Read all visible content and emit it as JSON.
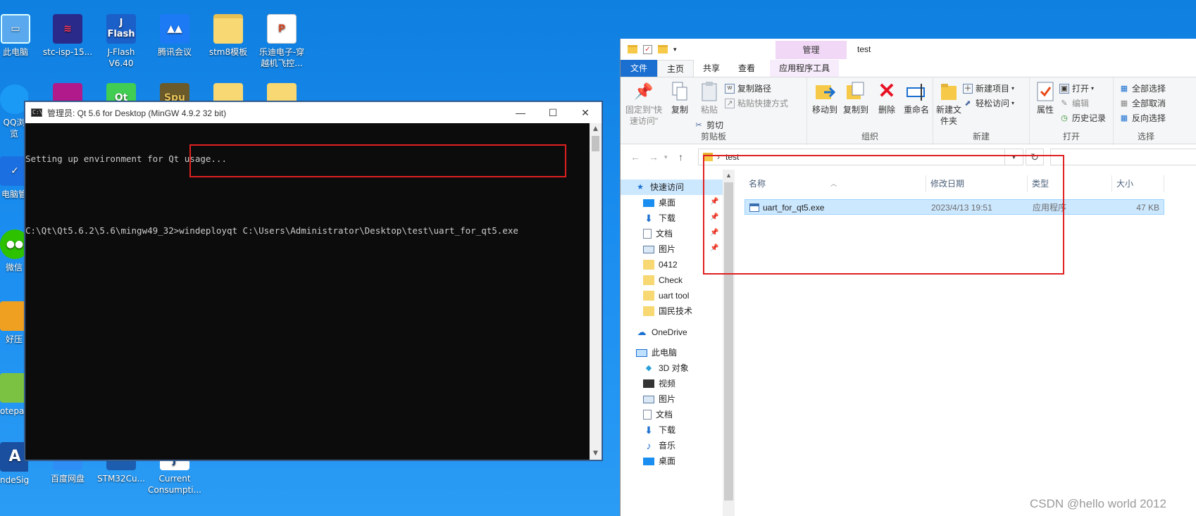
{
  "desktop": {
    "icons": [
      {
        "label": "此电脑",
        "icon": "computer-icon",
        "color": "#3a8fd8"
      },
      {
        "label": "stc-isp-15...",
        "icon": "stc-isp-icon",
        "color": "#c8234a"
      },
      {
        "label": "J-Flash V6.40",
        "icon": "jflash-icon",
        "color": "#1b5fc9"
      },
      {
        "label": "腾讯会议",
        "icon": "tencent-meeting-icon",
        "color": "#1d7af5"
      },
      {
        "label": "stm8模板",
        "icon": "folder-icon",
        "color": "#f7d873"
      },
      {
        "label": "乐迪电子-穿越机飞控...",
        "icon": "ppt-file-icon",
        "color": "#d24726"
      },
      {
        "label": "QQ浏览",
        "icon": "qq-browser-icon",
        "color": "#1b9af5"
      },
      {
        "label": "电脑管",
        "icon": "pc-manager-icon",
        "color": "#1b6fe0"
      },
      {
        "label": "微信",
        "icon": "wechat-icon",
        "color": "#2dc100"
      },
      {
        "label": "好压",
        "icon": "haozip-icon",
        "color": "#f0a020"
      },
      {
        "label": "otepad",
        "icon": "notepad-icon",
        "color": "#7cc242"
      },
      {
        "label": "ndeSigh...",
        "icon": "insight-icon",
        "color": "#1a4fa0"
      },
      {
        "label": "百度网盘",
        "icon": "baidu-netdisk-icon",
        "color": "#2f8ef5"
      },
      {
        "label": "STM32Cu...",
        "icon": "stm32cube-icon",
        "color": "#1c5db0"
      },
      {
        "label": "Current Consumpti...",
        "icon": "current-consumption-icon",
        "color": "#0f3f7f"
      }
    ]
  },
  "console": {
    "title": "管理员: Qt 5.6 for Desktop (MinGW 4.9.2 32 bit)",
    "lines": [
      "Setting up environment for Qt usage...",
      "C:\\Qt\\Qt5.6.2\\5.6\\mingw49_32>windeployqt C:\\Users\\Administrator\\Desktop\\test\\uart_for_qt5.exe"
    ],
    "minimize": "—",
    "maximize": "☐",
    "close": "✕"
  },
  "explorer": {
    "window_title": "test",
    "context_tab": "管理",
    "tabs": [
      "文件",
      "主页",
      "共享",
      "查看",
      "应用程序工具"
    ],
    "ribbon": {
      "clipboard": {
        "name": "剪贴板",
        "pin": "固定到\"快速访问\"",
        "copy": "复制",
        "paste": "粘贴",
        "copy_path": "复制路径",
        "paste_shortcut": "粘贴快捷方式",
        "cut": "剪切"
      },
      "organize": {
        "name": "组织",
        "move_to": "移动到",
        "copy_to": "复制到",
        "delete": "删除",
        "rename": "重命名"
      },
      "new": {
        "name": "新建",
        "new_folder": "新建文件夹",
        "new_item": "新建项目",
        "easy_access": "轻松访问"
      },
      "open": {
        "name": "打开",
        "properties": "属性",
        "open": "打开",
        "edit": "编辑",
        "history": "历史记录"
      },
      "select": {
        "name": "选择",
        "select_all": "全部选择",
        "select_none": "全部取消",
        "invert": "反向选择"
      }
    },
    "address": {
      "path": "test"
    },
    "nav": {
      "quick_access": "快速访问",
      "items": [
        "桌面",
        "下载",
        "文档",
        "图片",
        "0412",
        "Check",
        "uart tool",
        "国民技术"
      ],
      "onedrive": "OneDrive",
      "this_pc": "此电脑",
      "pc_items": [
        "3D 对象",
        "视频",
        "图片",
        "文档",
        "下载",
        "音乐",
        "桌面"
      ]
    },
    "columns": [
      "名称",
      "修改日期",
      "类型",
      "大小"
    ],
    "files": [
      {
        "name": "uart_for_qt5.exe",
        "date": "2023/4/13 19:51",
        "type": "应用程序",
        "size": "47 KB"
      }
    ]
  },
  "watermark": "CSDN @hello world 2012"
}
